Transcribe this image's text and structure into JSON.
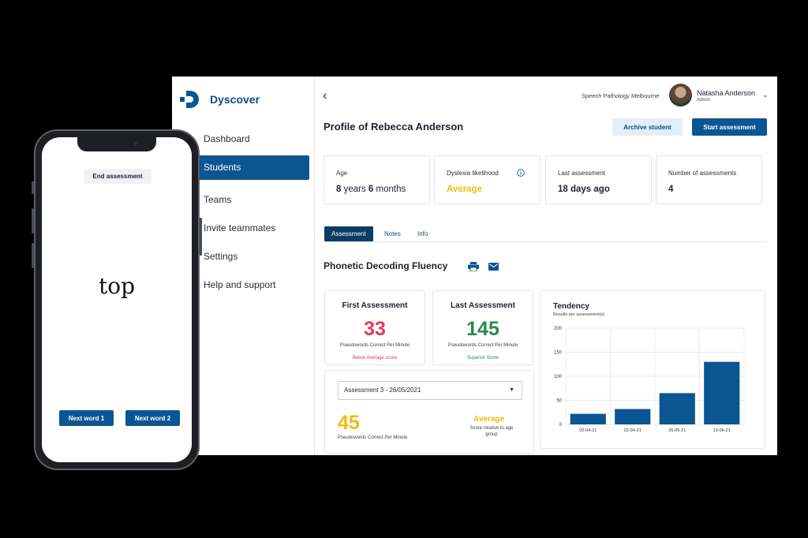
{
  "app": {
    "brand": "Dyscover",
    "sidebar": {
      "items": [
        {
          "label": "Dashboard",
          "active": false
        },
        {
          "label": "Students",
          "active": true
        },
        {
          "label": "Teams",
          "active": false
        },
        {
          "label": "Invite teammates",
          "active": false
        },
        {
          "label": "Settings",
          "active": false
        },
        {
          "label": "Help and support",
          "active": false
        }
      ]
    },
    "header": {
      "back_icon": "‹",
      "organization": "Speech Pathology Melbourne",
      "user_name": "Natasha Anderson",
      "user_role": "Admin",
      "chevron": "⌄"
    },
    "profile": {
      "title": "Profile of Rebecca Anderson",
      "archive_label": "Archive student",
      "start_label": "Start assessment"
    },
    "stats": {
      "age_label": "Age",
      "age_years": "8",
      "age_years_unit": " years ",
      "age_months": "6",
      "age_months_unit": " months",
      "dyslexia_label": "Dyslexia likelihood",
      "dyslexia_value": "Average",
      "last_label": "Last assessment",
      "last_value": "18 days ago",
      "count_label": "Number of assessments",
      "count_value": "4"
    },
    "tabs": [
      "Assessment",
      "Notes",
      "Info"
    ],
    "section_title": "Phonetic Decoding Fluency",
    "first": {
      "title": "First Assessment",
      "value": "33",
      "sub": "Pseudowords Correct Per Minute",
      "note": "Below Average score"
    },
    "last": {
      "title": "Last Assessment",
      "value": "145",
      "sub": "Pseudowords Correct Per Minute",
      "note": "Superior Score"
    },
    "selected": {
      "select_value": "Assessment 3 - 26/05/2021",
      "value": "45",
      "sub": "Pseudowords Correct Per Minute",
      "rating": "Average",
      "rating_sub": "Score relative to age group"
    },
    "colors": {
      "primary": "#0c5593",
      "red": "#e23c5b",
      "green": "#2a8b4a",
      "yellow": "#f0bb12"
    }
  },
  "chart_data": {
    "type": "bar",
    "title": "Tendency",
    "subtitle": "Results per assessment(s)",
    "categories": [
      "02-04-21",
      "22-04-21",
      "26-05-21",
      "13-06-21"
    ],
    "values": [
      22,
      32,
      65,
      130
    ],
    "ylim": [
      0,
      200
    ],
    "yticks": [
      0,
      50,
      100,
      150,
      200
    ],
    "grid": true,
    "color": "#0c5593"
  },
  "phone": {
    "end_label": "End assessment",
    "word": "top",
    "next1_label": "Next word 1",
    "next2_label": "Next word 2"
  }
}
